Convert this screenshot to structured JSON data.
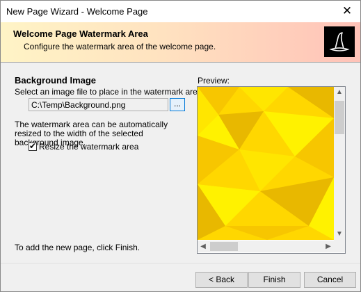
{
  "window": {
    "title": "New Page Wizard - Welcome Page",
    "close_glyph": "✕"
  },
  "header": {
    "title": "Welcome Page Watermark Area",
    "subtitle": "Configure the watermark area of the welcome page.",
    "logo_icon": "wizard-hat-icon"
  },
  "background": {
    "section_title": "Background Image",
    "select_label": "Select an image file to place in the watermark area:",
    "path_value": "C:\\Temp\\Background.png",
    "browse_label": "..."
  },
  "resize": {
    "info_text": "The watermark area can be automatically resized to the width of the selected background image.",
    "checkbox_label": "Resize the watermark area",
    "checked": true,
    "check_glyph": "✔"
  },
  "finish_hint": "To add the new page, click Finish.",
  "preview": {
    "label": "Preview:",
    "colors": [
      "#ffd700",
      "#f7c600",
      "#ffe600",
      "#e8b800",
      "#fff200"
    ]
  },
  "buttons": {
    "back": "< Back",
    "finish": "Finish",
    "cancel": "Cancel"
  },
  "scrollbar_glyphs": {
    "up": "▲",
    "down": "▼",
    "left": "◀",
    "right": "▶"
  }
}
